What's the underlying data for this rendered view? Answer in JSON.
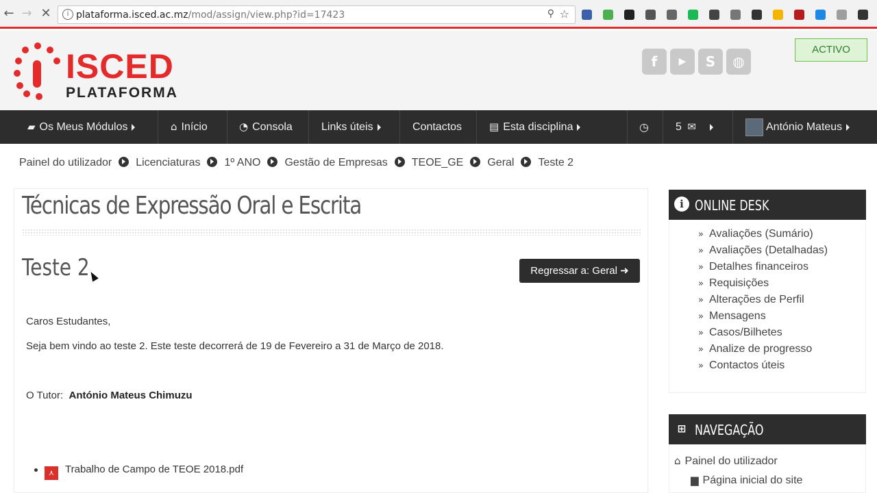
{
  "browser": {
    "url_host": "plataforma.isced.ac.mz",
    "url_path": "/mod/assign/view.php?id=17423",
    "back_icon": "arrow-left-icon",
    "forward_icon": "arrow-right-icon",
    "reload_icon": "stop-icon",
    "zoom_icon": "zoom-icon",
    "star_icon": "bookmark-star-icon",
    "extension_colors": [
      "#3b5fa8",
      "#4caf50",
      "#222222",
      "#555555",
      "#666666",
      "#1db954",
      "#444444",
      "#777777",
      "#333333",
      "#f4b400",
      "#b71c1c",
      "#1e88e5",
      "#9e9e9e",
      "#333333"
    ]
  },
  "header": {
    "logo_text": "ISCED",
    "logo_subtext": "PLATAFORMA",
    "logo_letter": "i",
    "brand_color": "#e32b2b",
    "social": [
      {
        "icon": "facebook-icon",
        "glyph": "f"
      },
      {
        "icon": "youtube-icon",
        "glyph": "▶"
      },
      {
        "icon": "skype-icon",
        "glyph": "S"
      },
      {
        "icon": "globe-icon",
        "glyph": "◍"
      }
    ],
    "status": "ACTIVO"
  },
  "mainnav": {
    "items": [
      {
        "icon": "briefcase-icon",
        "glyph": "▰",
        "label": "Os Meus Módulos",
        "caret": true
      },
      {
        "icon": "home-icon",
        "glyph": "⌂",
        "label": "Início",
        "caret": false
      },
      {
        "icon": "dashboard-icon",
        "glyph": "◔",
        "label": "Consola",
        "caret": false
      },
      {
        "icon": "",
        "glyph": "",
        "label": "Links úteis",
        "caret": true
      },
      {
        "icon": "",
        "glyph": "",
        "label": "Contactos",
        "caret": false
      },
      {
        "icon": "book-icon",
        "glyph": "▤",
        "label": "Esta disciplina",
        "caret": true
      }
    ],
    "clock_icon": "clock-icon",
    "messages_count": "5",
    "messages_icon": "envelope-icon",
    "user_name": "António Mateus"
  },
  "breadcrumb": [
    "Painel do utilizador",
    "Licenciaturas",
    "1º ANO",
    "Gestão de Empresas",
    "TEOE_GE",
    "Geral",
    "Teste 2"
  ],
  "main": {
    "course_title": "Técnicas de Expressão Oral e Escrita",
    "assignment_title": "Teste 2",
    "back_button": "Regressar a: Geral",
    "greeting": "Caros Estudantes,",
    "body": "Seja bem vindo ao teste 2. Este teste decorrerá de 19 de Fevereiro a 31 de Março de 2018.",
    "tutor_label": "O Tutor:",
    "tutor_name": "António Mateus Chimuzu",
    "file_name": "Trabalho de Campo de TEOE 2018.pdf",
    "file_icon": "pdf-icon"
  },
  "online_desk": {
    "title": "ONLINE DESK",
    "icon": "info-icon",
    "links": [
      "Avaliações (Sumário)",
      "Avaliações (Detalhadas)",
      "Detalhes financeiros",
      "Requisições",
      "Alterações de Perfil",
      "Mensagens",
      "Casos/Bilhetes",
      "Analize de progresso",
      "Contactos úteis"
    ]
  },
  "navegacao": {
    "title": "NAVEGAÇÃO",
    "icon": "sitemap-icon",
    "links": [
      {
        "icon": "home-icon",
        "label": "Painel do utilizador"
      },
      {
        "icon": "file-icon",
        "label": "Página inicial do site"
      }
    ]
  }
}
